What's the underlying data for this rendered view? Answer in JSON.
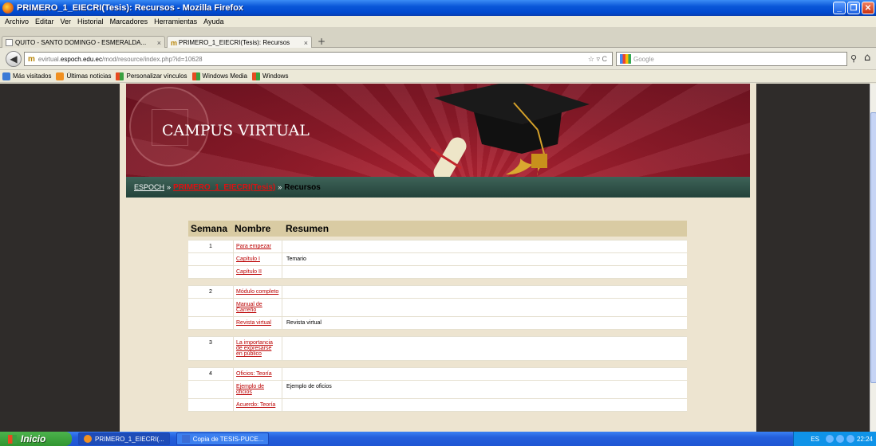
{
  "window": {
    "title": "PRIMERO_1_EIECRI(Tesis): Recursos - Mozilla Firefox"
  },
  "menu": [
    "Archivo",
    "Editar",
    "Ver",
    "Historial",
    "Marcadores",
    "Herramientas",
    "Ayuda"
  ],
  "tabs": [
    {
      "label": "QUITO - SANTO DOMINGO - ESMERALDA..."
    },
    {
      "label": "PRIMERO_1_EIECRI(Tesis): Recursos"
    }
  ],
  "nav": {
    "url_prefix": "evirtual.",
    "url_host": "espoch.edu.ec",
    "url_path": "/mod/resource/index.php?id=10628",
    "search_placeholder": "Google"
  },
  "bookmarks": [
    "Más visitados",
    "Últimas noticias",
    "Personalizar vínculos",
    "Windows Media",
    "Windows"
  ],
  "banner": {
    "title": "CAMPUS VIRTUAL"
  },
  "breadcrumb": {
    "home": "ESPOCH",
    "course": "PRIMERO_1_EIECRI(Tesis)",
    "current": "Recursos",
    "sep": "»"
  },
  "table": {
    "headers": [
      "Semana",
      "Nombre",
      "Resumen"
    ],
    "groups": [
      {
        "week": "1",
        "rows": [
          {
            "name": "Para empezar",
            "summary": ""
          },
          {
            "name": "Capítulo I",
            "summary": "Temario"
          },
          {
            "name": "Capítulo II",
            "summary": ""
          }
        ]
      },
      {
        "week": "2",
        "rows": [
          {
            "name": "Módulo completo",
            "summary": ""
          },
          {
            "name": "Manual de Carreño",
            "summary": ""
          },
          {
            "name": "Revista virtual",
            "summary": "Revista virtual"
          }
        ]
      },
      {
        "week": "3",
        "rows": [
          {
            "name": "La importancia de expresarse en público",
            "summary": ""
          }
        ]
      },
      {
        "week": "4",
        "rows": [
          {
            "name": "Oficios: Teoría",
            "summary": ""
          },
          {
            "name": "Ejemplo de oficios",
            "summary": "Ejemplo de oficios"
          },
          {
            "name": "Acuerdo: Teoría",
            "summary": ""
          }
        ]
      }
    ]
  },
  "taskbar": {
    "start": "Inicio",
    "tasks": [
      "PRIMERO_1_EIECRI(...",
      "Copia de TESIS-PUCE..."
    ],
    "lang": "ES",
    "clock": "22:24"
  }
}
